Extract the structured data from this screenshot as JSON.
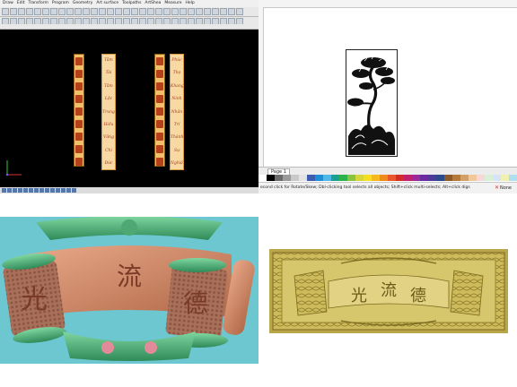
{
  "top_left": {
    "menu": [
      "Draw",
      "Edit",
      "Transform",
      "Program",
      "Geometry",
      "Art surface",
      "Toolpaths",
      "ArtShea",
      "Measure",
      "Help"
    ],
    "han_columns": [
      [
        "德",
        "财",
        "治",
        "樊",
        "忠",
        "孝",
        "仁",
        "爱",
        "信"
      ],
      [
        "至",
        "合",
        "康",
        "喜",
        "仁",
        "礼",
        "信",
        "和",
        "泰"
      ]
    ],
    "vn_columns": [
      [
        "Tâm",
        "Tài",
        "Tâm",
        "Lộc",
        "Trung",
        "Hiếu",
        "Vững",
        "Chí",
        "Đức"
      ],
      [
        "Phúc",
        "Thọ",
        "Khang",
        "Ninh",
        "Nhân",
        "Trí",
        "Thành",
        "Sự",
        "Nghiệp"
      ]
    ],
    "colors": {
      "viewport": "#000000",
      "plate": "#f3c06a",
      "vn_plate": "#f8d9a4",
      "ink": "#b5401a"
    }
  },
  "top_right": {
    "page_tab": "Page 1",
    "status_message": "econd click for Rotate/Skew; Dbl-clicking tool selects all objects; Shift+click multi-selects; Alt+click digs",
    "fill_label": "None",
    "palette": [
      "#ffffff",
      "#000000",
      "#6b6b6b",
      "#9a9a9a",
      "#c9c9c9",
      "#e3e3e3",
      "#3b5cb0",
      "#1d8fd6",
      "#4fb8e8",
      "#1aa08e",
      "#2bb24a",
      "#8ac43f",
      "#d6d63a",
      "#f5e020",
      "#f6b81c",
      "#f08a1c",
      "#e8562a",
      "#d42a2a",
      "#c0206c",
      "#9a2a9a",
      "#6a2aa0",
      "#4a3a9a",
      "#2a4a8a",
      "#8a5a2a",
      "#b57a3a",
      "#d4a06a",
      "#f0c89a",
      "#f7d7d7",
      "#d7f0d7",
      "#d7e3f7",
      "#f0f0b0",
      "#b0e0f0"
    ]
  },
  "bottom_left": {
    "chars": [
      "光",
      "流",
      "德"
    ],
    "colors": {
      "bg": "#6cc7d1",
      "jade": "#3fa06a",
      "scroll": "#d08a6a"
    }
  },
  "bottom_right": {
    "chars": [
      "光",
      "流",
      "德"
    ],
    "colors": {
      "gold": "#c8b656"
    }
  }
}
